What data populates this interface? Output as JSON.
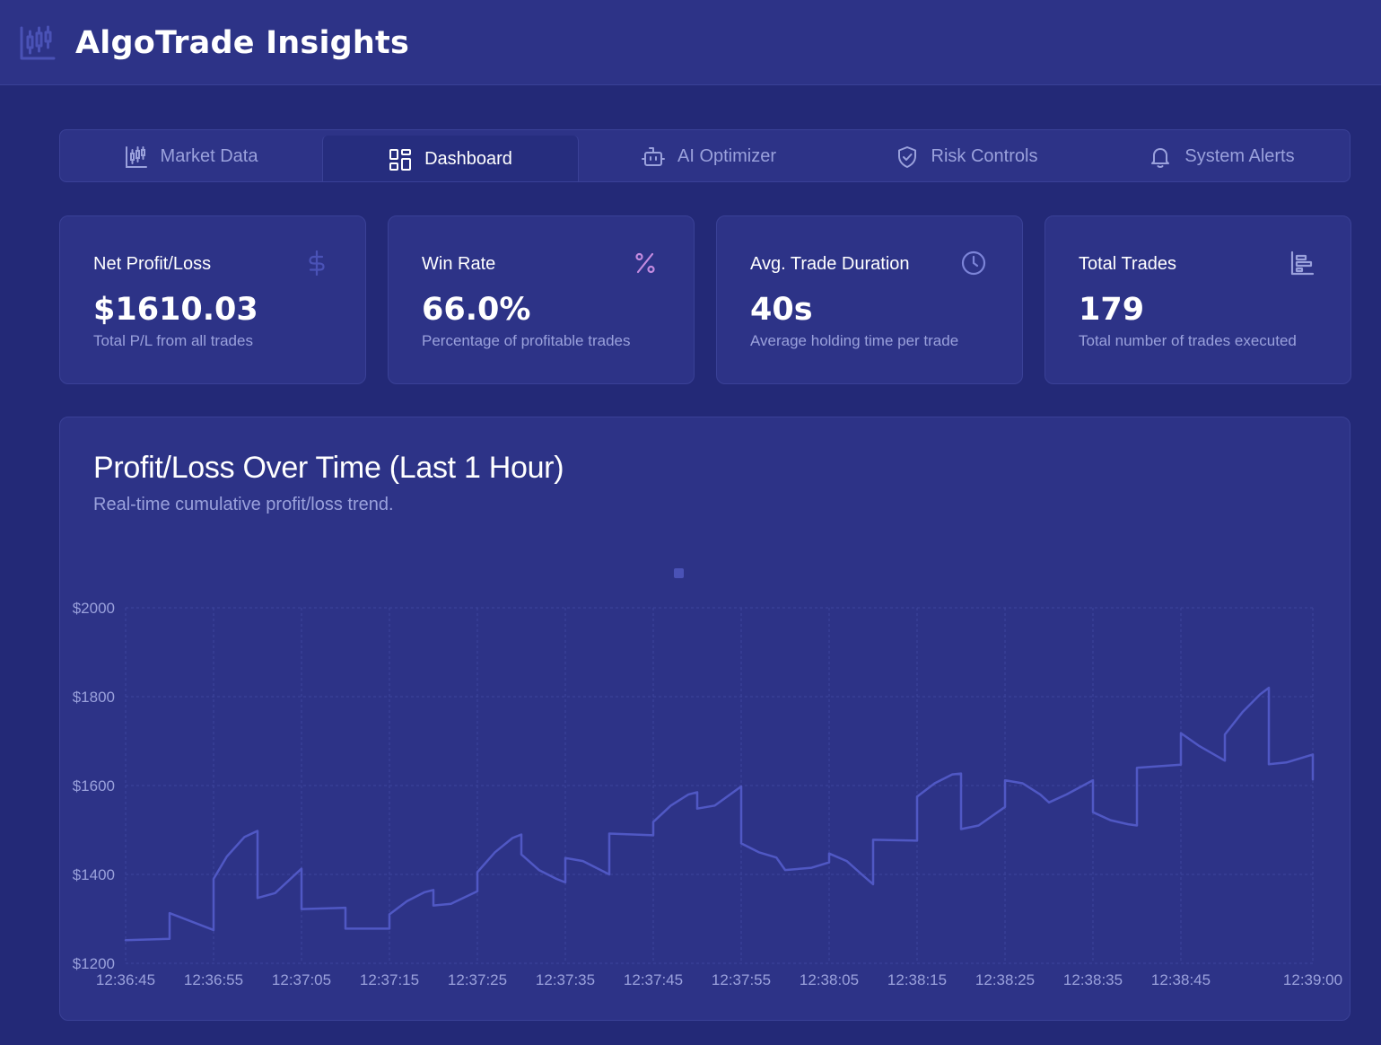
{
  "header": {
    "title": "AlgoTrade Insights",
    "logo_icon": "candlestick-chart-icon"
  },
  "tabs": [
    {
      "label": "Market Data",
      "icon": "candlestick-chart-icon",
      "active": false
    },
    {
      "label": "Dashboard",
      "icon": "dashboard-grid-icon",
      "active": true
    },
    {
      "label": "AI Optimizer",
      "icon": "robot-icon",
      "active": false
    },
    {
      "label": "Risk Controls",
      "icon": "shield-check-icon",
      "active": false
    },
    {
      "label": "System Alerts",
      "icon": "bell-icon",
      "active": false
    }
  ],
  "cards": [
    {
      "title": "Net Profit/Loss",
      "value": "$1610.03",
      "subtitle": "Total P/L from all trades",
      "icon": "dollar-icon",
      "icon_color": "#4a52b6"
    },
    {
      "title": "Win Rate",
      "value": "66.0%",
      "subtitle": "Percentage of profitable trades",
      "icon": "percent-icon",
      "icon_color": "#c48be0"
    },
    {
      "title": "Avg. Trade Duration",
      "value": "40s",
      "subtitle": "Average holding time per trade",
      "icon": "clock-icon",
      "icon_color": "#7c84d8"
    },
    {
      "title": "Total Trades",
      "value": "179",
      "subtitle": "Total number of trades executed",
      "icon": "bar-chart-icon",
      "icon_color": "#9aa1dc"
    }
  ],
  "chart_panel": {
    "title": "Profit/Loss Over Time (Last 1 Hour)",
    "subtitle": "Real-time cumulative profit/loss trend."
  },
  "colors": {
    "background": "#232977",
    "panel": "#2d3387",
    "line": "#5058c4",
    "muted_text": "#9aa1dc"
  },
  "chart_data": {
    "type": "line",
    "title": "Profit/Loss Over Time (Last 1 Hour)",
    "xlabel": "",
    "ylabel": "",
    "ylim": [
      1200,
      2000
    ],
    "yticks": [
      {
        "value": 1200,
        "label": "$1200"
      },
      {
        "value": 1400,
        "label": "$1400"
      },
      {
        "value": 1600,
        "label": "$1600"
      },
      {
        "value": 1800,
        "label": "$1800"
      },
      {
        "value": 2000,
        "label": "$2000"
      }
    ],
    "xlim_seconds": [
      0,
      135
    ],
    "xticks": [
      {
        "t": 0,
        "label": "12:36:45"
      },
      {
        "t": 10,
        "label": "12:36:55"
      },
      {
        "t": 20,
        "label": "12:37:05"
      },
      {
        "t": 30,
        "label": "12:37:15"
      },
      {
        "t": 40,
        "label": "12:37:25"
      },
      {
        "t": 50,
        "label": "12:37:35"
      },
      {
        "t": 60,
        "label": "12:37:45"
      },
      {
        "t": 70,
        "label": "12:37:55"
      },
      {
        "t": 80,
        "label": "12:38:05"
      },
      {
        "t": 90,
        "label": "12:38:15"
      },
      {
        "t": 100,
        "label": "12:38:25"
      },
      {
        "t": 110,
        "label": "12:38:35"
      },
      {
        "t": 120,
        "label": "12:38:45"
      },
      {
        "t": 135,
        "label": "12:39:00"
      }
    ],
    "grid": true,
    "legend": "top-center",
    "series": [
      {
        "color": "#5058c4",
        "points": [
          [
            0,
            1252
          ],
          [
            5,
            1255
          ],
          [
            5,
            1313
          ],
          [
            10,
            1275
          ],
          [
            10,
            1390
          ],
          [
            11.5,
            1440
          ],
          [
            13.5,
            1484
          ],
          [
            15,
            1498
          ],
          [
            15,
            1347
          ],
          [
            17,
            1358
          ],
          [
            20,
            1413
          ],
          [
            20,
            1322
          ],
          [
            25,
            1325
          ],
          [
            25,
            1278
          ],
          [
            30,
            1278
          ],
          [
            30,
            1310
          ],
          [
            32,
            1340
          ],
          [
            34,
            1360
          ],
          [
            35,
            1365
          ],
          [
            35,
            1330
          ],
          [
            37,
            1334
          ],
          [
            40,
            1362
          ],
          [
            40,
            1405
          ],
          [
            42,
            1450
          ],
          [
            44,
            1482
          ],
          [
            45,
            1490
          ],
          [
            45,
            1445
          ],
          [
            47,
            1410
          ],
          [
            49,
            1390
          ],
          [
            50,
            1382
          ],
          [
            50,
            1437
          ],
          [
            52,
            1430
          ],
          [
            55,
            1400
          ],
          [
            55,
            1492
          ],
          [
            60,
            1488
          ],
          [
            60,
            1518
          ],
          [
            62,
            1555
          ],
          [
            64,
            1580
          ],
          [
            65,
            1585
          ],
          [
            65,
            1548
          ],
          [
            67,
            1555
          ],
          [
            70,
            1598
          ],
          [
            70,
            1470
          ],
          [
            72,
            1450
          ],
          [
            74,
            1438
          ],
          [
            75,
            1410
          ],
          [
            78,
            1415
          ],
          [
            80,
            1427
          ],
          [
            80,
            1447
          ],
          [
            82,
            1430
          ],
          [
            84,
            1395
          ],
          [
            85,
            1378
          ],
          [
            85,
            1478
          ],
          [
            90,
            1476
          ],
          [
            90,
            1575
          ],
          [
            92,
            1605
          ],
          [
            94,
            1625
          ],
          [
            95,
            1627
          ],
          [
            95,
            1502
          ],
          [
            97,
            1510
          ],
          [
            100,
            1552
          ],
          [
            100,
            1612
          ],
          [
            102,
            1605
          ],
          [
            104,
            1580
          ],
          [
            105,
            1562
          ],
          [
            107,
            1580
          ],
          [
            110,
            1612
          ],
          [
            110,
            1540
          ],
          [
            112,
            1522
          ],
          [
            114,
            1513
          ],
          [
            115,
            1510
          ],
          [
            115,
            1640
          ],
          [
            120,
            1647
          ],
          [
            120,
            1718
          ],
          [
            122,
            1690
          ],
          [
            125,
            1656
          ],
          [
            125,
            1715
          ],
          [
            127,
            1765
          ],
          [
            129,
            1805
          ],
          [
            130,
            1820
          ],
          [
            130,
            1648
          ],
          [
            132,
            1652
          ],
          [
            135,
            1670
          ],
          [
            135,
            1614
          ]
        ]
      }
    ]
  }
}
